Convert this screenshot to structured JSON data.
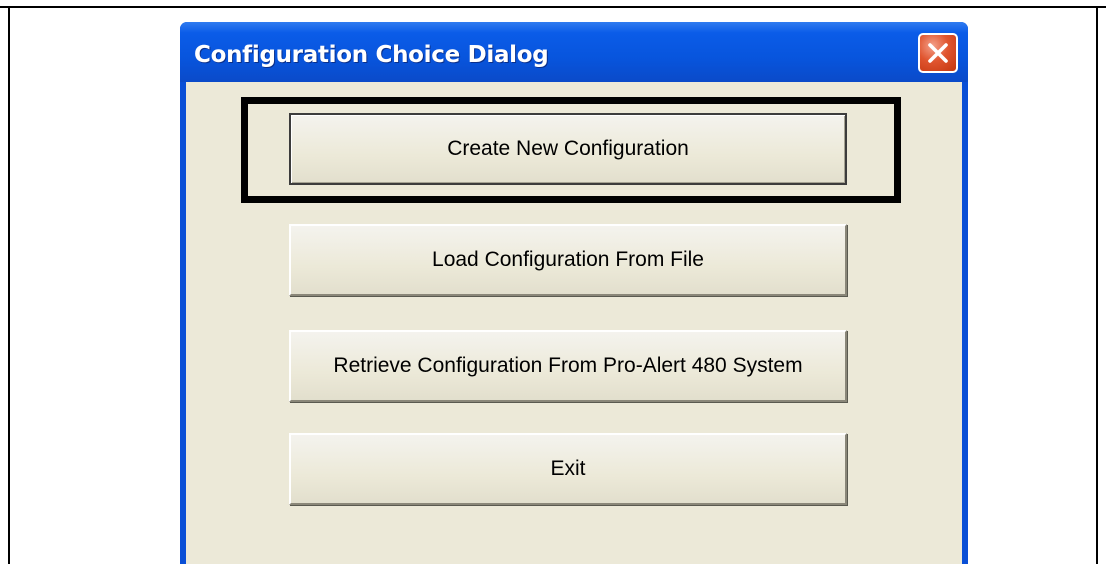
{
  "window": {
    "title": "Configuration Choice Dialog",
    "close_icon": "close-icon",
    "titlebar_color": "#0855dd",
    "close_color": "#e0552f",
    "client_color": "#ece9d8"
  },
  "buttons": {
    "create_new": "Create New Configuration",
    "load_from_file": "Load Configuration From File",
    "retrieve_from_system": "Retrieve Configuration From Pro-Alert 480 System",
    "exit": "Exit"
  },
  "highlight": {
    "target": "create_new",
    "color": "#000000"
  }
}
